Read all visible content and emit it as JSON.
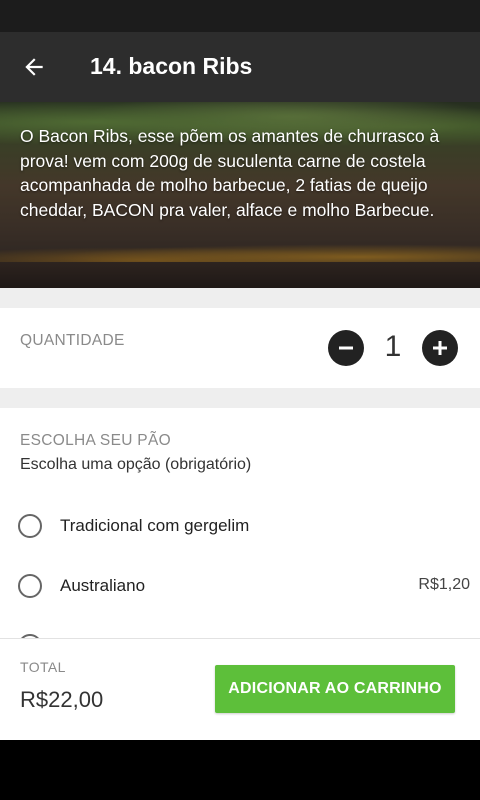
{
  "app_bar": {
    "title": "14. bacon Ribs",
    "back_icon": "arrow-left-icon"
  },
  "hero": {
    "description": "O Bacon Ribs, esse põem os amantes de churrasco à prova! vem com 200g de suculenta carne de costela  acompanhada de molho barbecue, 2 fatias de queijo cheddar, BACON pra valer, alface e molho Barbecue."
  },
  "quantity": {
    "label": "QUANTIDADE",
    "value": "1",
    "minus_icon": "minus-circle-icon",
    "plus_icon": "plus-circle-icon"
  },
  "bread": {
    "title": "ESCOLHA SEU PÃO",
    "subtitle": "Escolha uma opção (obrigatório)",
    "options": [
      {
        "label": "Tradicional com gergelim",
        "price": ""
      },
      {
        "label": "Australiano",
        "price": "R$1,20"
      },
      {
        "label": "",
        "price": ""
      }
    ]
  },
  "footer": {
    "total_label": "TOTAL",
    "total_value": "R$22,00",
    "add_button": "ADICIONAR AO CARRINHO"
  },
  "colors": {
    "app_bar": "#2d2d2d",
    "accent_green": "#5dbf3a",
    "section_gap": "#eeeeee"
  }
}
